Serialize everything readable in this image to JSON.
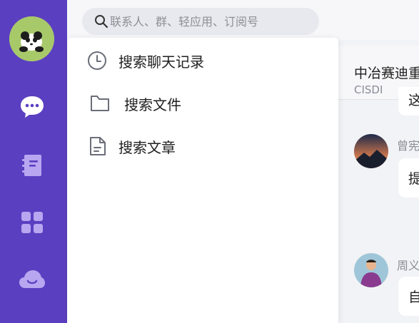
{
  "sidebar": {
    "accent": "#5b3fc1",
    "avatar_bg": "#a8c96a",
    "items": [
      {
        "name": "chat",
        "icon": "chat-bubble-icon"
      },
      {
        "name": "contacts",
        "icon": "address-book-icon"
      },
      {
        "name": "apps",
        "icon": "grid-apps-icon"
      },
      {
        "name": "cloud",
        "icon": "cloud-icon"
      }
    ]
  },
  "search": {
    "placeholder": "联系人、群、轻应用、订阅号",
    "icon": "search-icon"
  },
  "dropdown": {
    "items": [
      {
        "label": "搜索聊天记录",
        "icon": "clock-icon"
      },
      {
        "label": "搜索文件",
        "icon": "folder-icon"
      },
      {
        "label": "搜索文章",
        "icon": "document-icon"
      }
    ]
  },
  "chat": {
    "title": "中冶赛迪重",
    "subtitle": "CISDI",
    "messages": [
      {
        "sender": "",
        "text": "这"
      },
      {
        "sender": "曾宪",
        "text": "提"
      },
      {
        "sender": "周义",
        "text": "自"
      }
    ]
  }
}
